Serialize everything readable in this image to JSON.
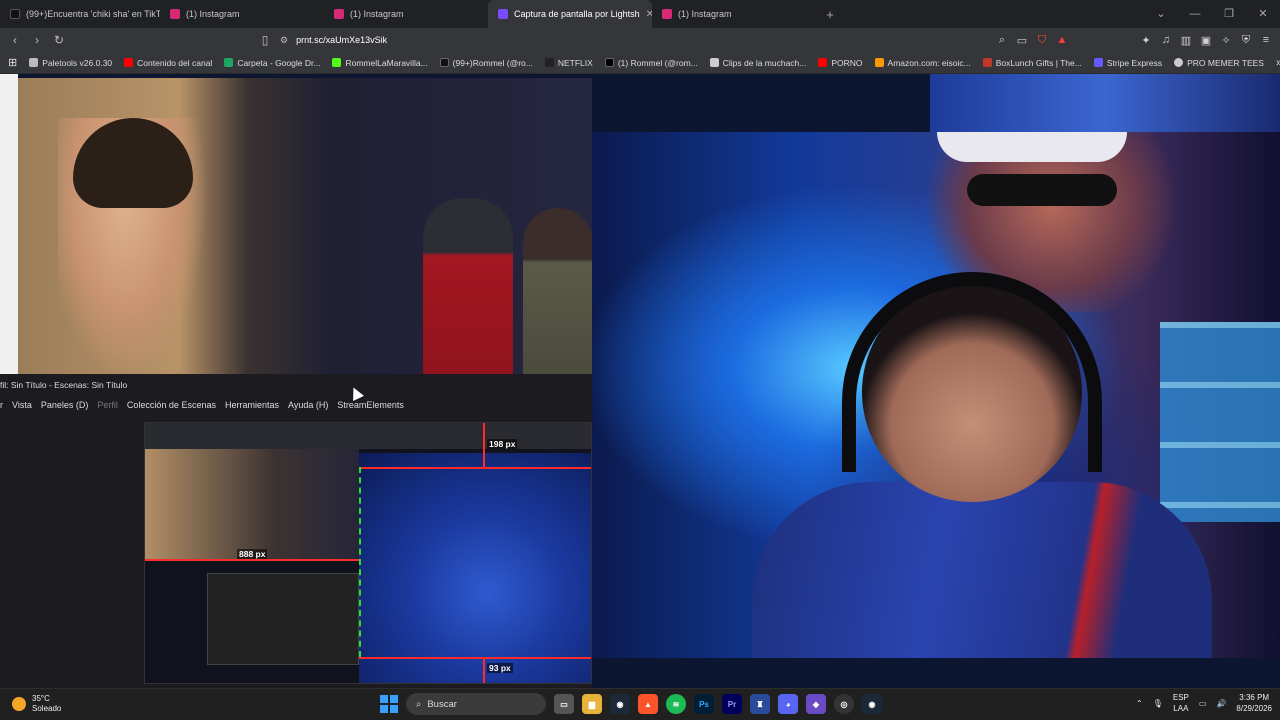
{
  "browser": {
    "tabs": [
      {
        "label": "(99+)Encuentra 'chiki sha' en TikTok |",
        "color": "#111111"
      },
      {
        "label": "(1) Instagram",
        "color": "#d62976"
      },
      {
        "label": "(1) Instagram",
        "color": "#d62976"
      },
      {
        "label": "Captura de pantalla por Lightsh",
        "color": "#7a4cff",
        "active": true
      },
      {
        "label": "(1) Instagram",
        "color": "#d62976"
      }
    ],
    "new_tab": "+",
    "url": "prnt.sc/xaUmXe13vSik",
    "bookmarks": [
      {
        "label": "Paletools v26.0.30",
        "color": "#bbbbbb"
      },
      {
        "label": "Contenido del canal",
        "color": "#ff0000"
      },
      {
        "label": "Carpeta - Google Dr...",
        "color": "#1fa463"
      },
      {
        "label": "RommelLaMaravilla...",
        "color": "#53fc18"
      },
      {
        "label": "(99+)Rommel (@ro...",
        "color": "#111111"
      },
      {
        "label": "NETFLIX",
        "color": "#e50914"
      },
      {
        "label": "(1) Rommel (@rom...",
        "color": "#000000"
      },
      {
        "label": "Clips de la muchach...",
        "color": "#cccccc"
      },
      {
        "label": "PORNO",
        "color": "#ff0000"
      },
      {
        "label": "Amazon.com: eisoic...",
        "color": "#ff9900"
      },
      {
        "label": "BoxLunch Gifts | The...",
        "color": "#c0392b"
      },
      {
        "label": "Stripe Express",
        "color": "#635bff"
      },
      {
        "label": "PRO MEMER TEES",
        "color": "#cccccc"
      }
    ]
  },
  "obs": {
    "title": "fil: Sin Título - Escenas: Sin Título",
    "menu": [
      "r",
      "Vista",
      "Paneles (D)",
      "Perfil",
      "Colección de Escenas",
      "Herramientas",
      "Ayuda (H)",
      "StreamElements"
    ],
    "measures": {
      "top": "198 px",
      "left": "888 px",
      "bottom": "93 px"
    }
  },
  "taskbar": {
    "temperature": "35°C",
    "condition": "Soleado",
    "search_label": "Buscar",
    "lang_top": "ESP",
    "lang_bottom": "LAA",
    "time": "3:36 PM",
    "date": "8/29/2026"
  }
}
